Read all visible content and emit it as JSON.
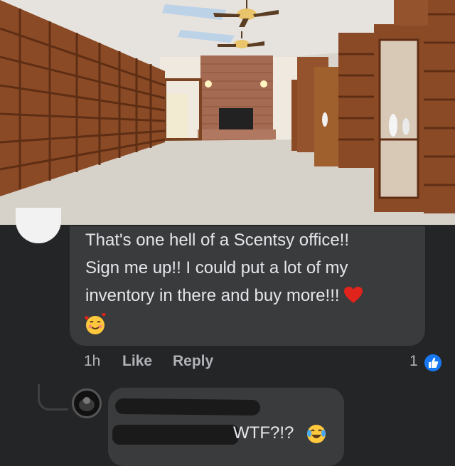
{
  "comment": {
    "text_lines": [
      "That's one hell of a Scentsy office!!",
      "Sign me up!! I could put a lot of my",
      "inventory in there and buy more!!!"
    ],
    "inline_emoji": "red-heart",
    "trailing_emoji": "smiling-face-with-hearts",
    "timestamp": "1h",
    "like_label": "Like",
    "reply_label": "Reply",
    "reaction_count": "1",
    "reaction_icon": "thumbs-up"
  },
  "reply": {
    "text": "WTF?!?",
    "emoji": "face-with-tears-of-joy"
  },
  "colors": {
    "background": "#242526",
    "bubble": "#3a3b3c",
    "text": "#e4e6eb",
    "secondary_text": "#b0b3b8",
    "like_blue": "#1877f2"
  }
}
